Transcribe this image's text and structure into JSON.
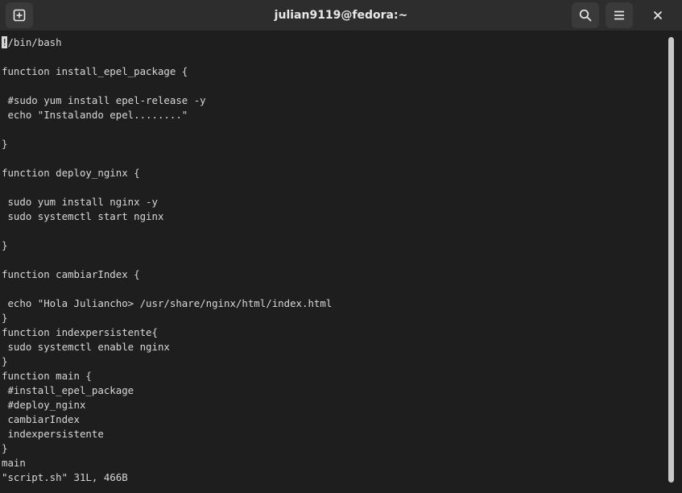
{
  "window": {
    "title": "julian9119@fedora:~"
  },
  "icons": {
    "new_tab": "new-tab-icon",
    "search": "search-icon",
    "menu": "hamburger-menu-icon",
    "close": "close-icon"
  },
  "terminal": {
    "cursor_char": "!",
    "first_line_rest": "/bin/bash",
    "lines": [
      "",
      "function install_epel_package {",
      "",
      " #sudo yum install epel-release -y",
      " echo \"Instalando epel........\"",
      "",
      "}",
      "",
      "function deploy_nginx {",
      "",
      " sudo yum install nginx -y",
      " sudo systemctl start nginx",
      "",
      "}",
      "",
      "function cambiarIndex {",
      "",
      " echo \"Hola Juliancho> /usr/share/nginx/html/index.html",
      "}",
      "function indexpersistente{",
      " sudo systemctl enable nginx",
      "}",
      "function main {",
      " #install_epel_package",
      " #deploy_nginx",
      " cambiarIndex",
      " indexpersistente",
      "}",
      "main"
    ],
    "status_line": "\"script.sh\" 31L, 466B"
  },
  "colors": {
    "background": "#1e1e1e",
    "titlebar": "#2d2d2d",
    "text": "#d8d8d8",
    "scroll_thumb": "#c8c8c8"
  }
}
